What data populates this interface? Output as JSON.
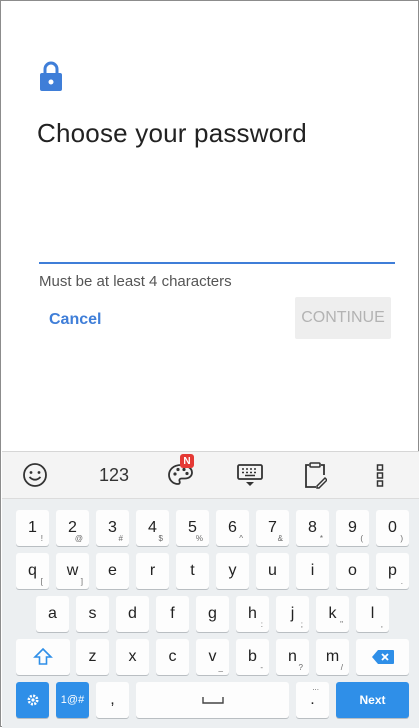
{
  "screen": {
    "title": "Choose your password",
    "password_value": "",
    "hint": "Must be at least 4 characters",
    "cancel_label": "Cancel",
    "continue_label": "CONTINUE"
  },
  "colors": {
    "accent": "#3f7ed8",
    "key_blue": "#2f8fe8",
    "badge": "#e53935"
  },
  "keyboard": {
    "toolbar": {
      "emoji_icon": "emoji-icon",
      "numbers_label": "123",
      "theme_badge": "N",
      "keyboard_icon": "keyboard-hide-icon",
      "clipboard_icon": "clipboard-icon",
      "more_icon": "more-vertical-icon"
    },
    "row1": [
      {
        "k": "1",
        "s": "!"
      },
      {
        "k": "2",
        "s": "@"
      },
      {
        "k": "3",
        "s": "#"
      },
      {
        "k": "4",
        "s": "$"
      },
      {
        "k": "5",
        "s": "%"
      },
      {
        "k": "6",
        "s": "^"
      },
      {
        "k": "7",
        "s": "&"
      },
      {
        "k": "8",
        "s": "*"
      },
      {
        "k": "9",
        "s": "("
      },
      {
        "k": "0",
        "s": ")"
      }
    ],
    "row2": [
      {
        "k": "q",
        "s": "["
      },
      {
        "k": "w",
        "s": "]"
      },
      {
        "k": "e",
        "s": ""
      },
      {
        "k": "r",
        "s": ""
      },
      {
        "k": "t",
        "s": ""
      },
      {
        "k": "y",
        "s": ""
      },
      {
        "k": "u",
        "s": ""
      },
      {
        "k": "i",
        "s": ""
      },
      {
        "k": "o",
        "s": ""
      },
      {
        "k": "p",
        "s": "."
      }
    ],
    "row3": [
      {
        "k": "a",
        "s": ""
      },
      {
        "k": "s",
        "s": ""
      },
      {
        "k": "d",
        "s": ""
      },
      {
        "k": "f",
        "s": ""
      },
      {
        "k": "g",
        "s": ""
      },
      {
        "k": "h",
        "s": ":"
      },
      {
        "k": "j",
        "s": ";"
      },
      {
        "k": "k",
        "s": "\""
      },
      {
        "k": "l",
        "s": ","
      }
    ],
    "row4": [
      {
        "k": "z",
        "s": ""
      },
      {
        "k": "x",
        "s": ""
      },
      {
        "k": "c",
        "s": ""
      },
      {
        "k": "v",
        "s": "_"
      },
      {
        "k": "b",
        "s": "-"
      },
      {
        "k": "n",
        "s": "?"
      },
      {
        "k": "m",
        "s": "/"
      }
    ],
    "bottom": {
      "settings_icon": "gear-icon",
      "symbols_label": "1@#",
      "comma_label": ",",
      "space_icon": "space-bar-icon",
      "period_label": ".",
      "period_sub": "...",
      "next_label": "Next"
    },
    "shift_icon": "shift-icon",
    "backspace_icon": "backspace-icon"
  }
}
